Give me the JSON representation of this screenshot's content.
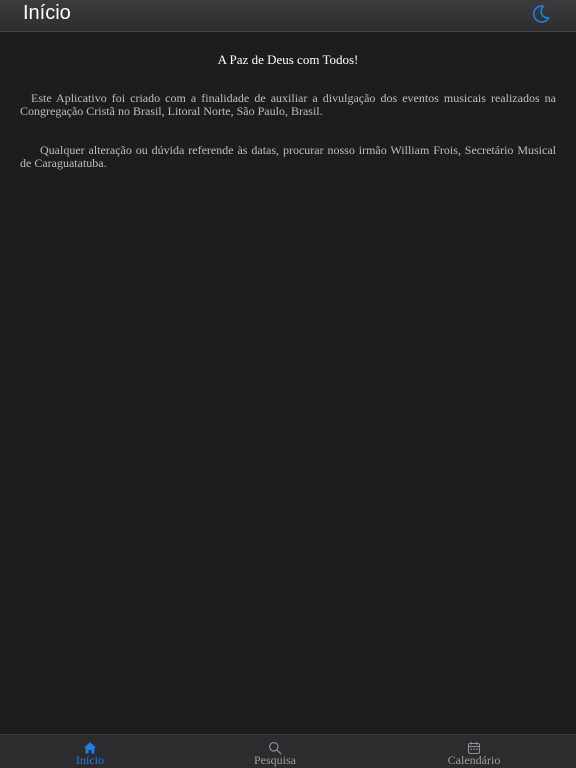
{
  "header": {
    "title": "Início",
    "theme_icon": "moon-icon",
    "accent_color": "#1f7fe5"
  },
  "main": {
    "greeting": "A Paz de Deus com Todos!",
    "paragraph1": "Este Aplicativo foi criado com a finalidade de auxiliar a divulgação dos eventos musicais realizados na Congregação Cristã no Brasil, Litoral Norte, São Paulo, Brasil.",
    "paragraph2": "Qualquer alteração ou dúvida referende às datas, procurar nosso irmão William Frois, Secretário Musical de Caraguatatuba."
  },
  "tabbar": {
    "tabs": [
      {
        "label": "Início",
        "icon": "home-icon",
        "active": true
      },
      {
        "label": "Pesquisa",
        "icon": "search-icon",
        "active": false
      },
      {
        "label": "Calendário",
        "icon": "calendar-icon",
        "active": false
      }
    ],
    "active_color": "#1f7fe5",
    "inactive_color": "#a0a0a0"
  }
}
